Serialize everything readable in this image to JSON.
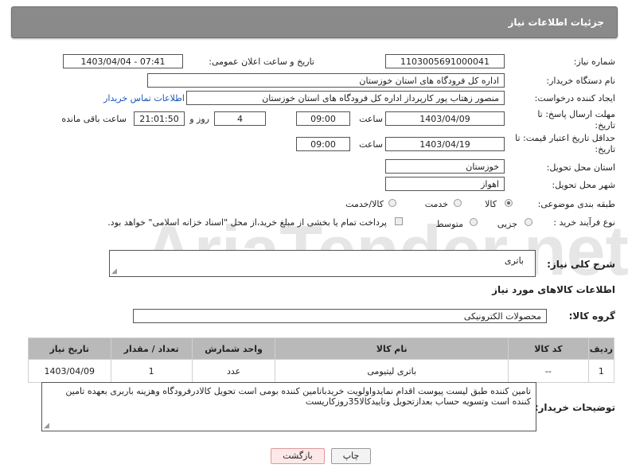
{
  "header": {
    "title": "جزئیات اطلاعات نیاز"
  },
  "fields": {
    "need_number_label": "شماره نیاز:",
    "need_number": "1103005691000041",
    "announce_label": "تاریخ و ساعت اعلان عمومی:",
    "announce_value": "1403/04/04 - 07:41",
    "buyer_org_label": "نام دستگاه خریدار:",
    "buyer_org": "اداره کل فرودگاه های استان خوزستان",
    "creator_label": "ایجاد کننده درخواست:",
    "creator": "منصور زهتاب پور کارپرداز اداره کل فرودگاه های استان خوزستان",
    "contact_link": "اطلاعات تماس خریدار",
    "deadline_label": "مهلت ارسال پاسخ: تا تاریخ:",
    "deadline_date": "1403/04/09",
    "time_label": "ساعت",
    "deadline_time": "09:00",
    "days": "4",
    "days_label": "روز و",
    "remaining_time": "21:01:50",
    "remaining_label": "ساعت باقی مانده",
    "validity_label": "حداقل تاریخ اعتبار قیمت: تا تاریخ:",
    "validity_date": "1403/04/19",
    "validity_time": "09:00",
    "province_label": "استان محل تحویل:",
    "province": "خوزستان",
    "city_label": "شهر محل تحویل:",
    "city": "اهواز",
    "category_label": "طبقه بندی موضوعی:",
    "category_options": [
      "کالا",
      "خدمت",
      "کالا/خدمت"
    ],
    "category_selected": "کالا",
    "process_label": "نوع فرآیند خرید :",
    "process_options": [
      "جزیی",
      "متوسط"
    ],
    "payment_note": "پرداخت تمام یا بخشی از مبلغ خرید،از محل \"اسناد خزانه اسلامی\" خواهد بود."
  },
  "description": {
    "label": "شرح کلی نیاز:",
    "value": "باتری"
  },
  "goods_section": {
    "title": "اطلاعات کالاهای مورد نیاز",
    "group_label": "گروه کالا:",
    "group_value": "محصولات الکترونیکی"
  },
  "table": {
    "headers": [
      "ردیف",
      "کد کالا",
      "نام کالا",
      "واحد شمارش",
      "تعداد / مقدار",
      "تاریخ نیاز"
    ],
    "rows": [
      [
        "1",
        "--",
        "باتری لیتیومی",
        "عدد",
        "1",
        "1403/04/09"
      ]
    ]
  },
  "buyer_notes": {
    "label": "توضیحات خریدار:",
    "value": "تامین کننده طبق لیست پیوست اقدام نمایدواولویت خریدباتامین کننده بومی است تحویل کالادرفرودگاه وهزینه باربری بعهده تامین کننده است وتسویه حساب بعدازتحویل وتاییدکالا35روزکاریست"
  },
  "buttons": {
    "print": "چاپ",
    "back": "بازگشت"
  },
  "watermark": {
    "text": "AriaTender.net"
  },
  "colors": {
    "header_bg": "#8a8a8a",
    "table_header_bg": "#b9b9b9",
    "link": "#1a55b8",
    "watermark": "#e3e3e3"
  }
}
